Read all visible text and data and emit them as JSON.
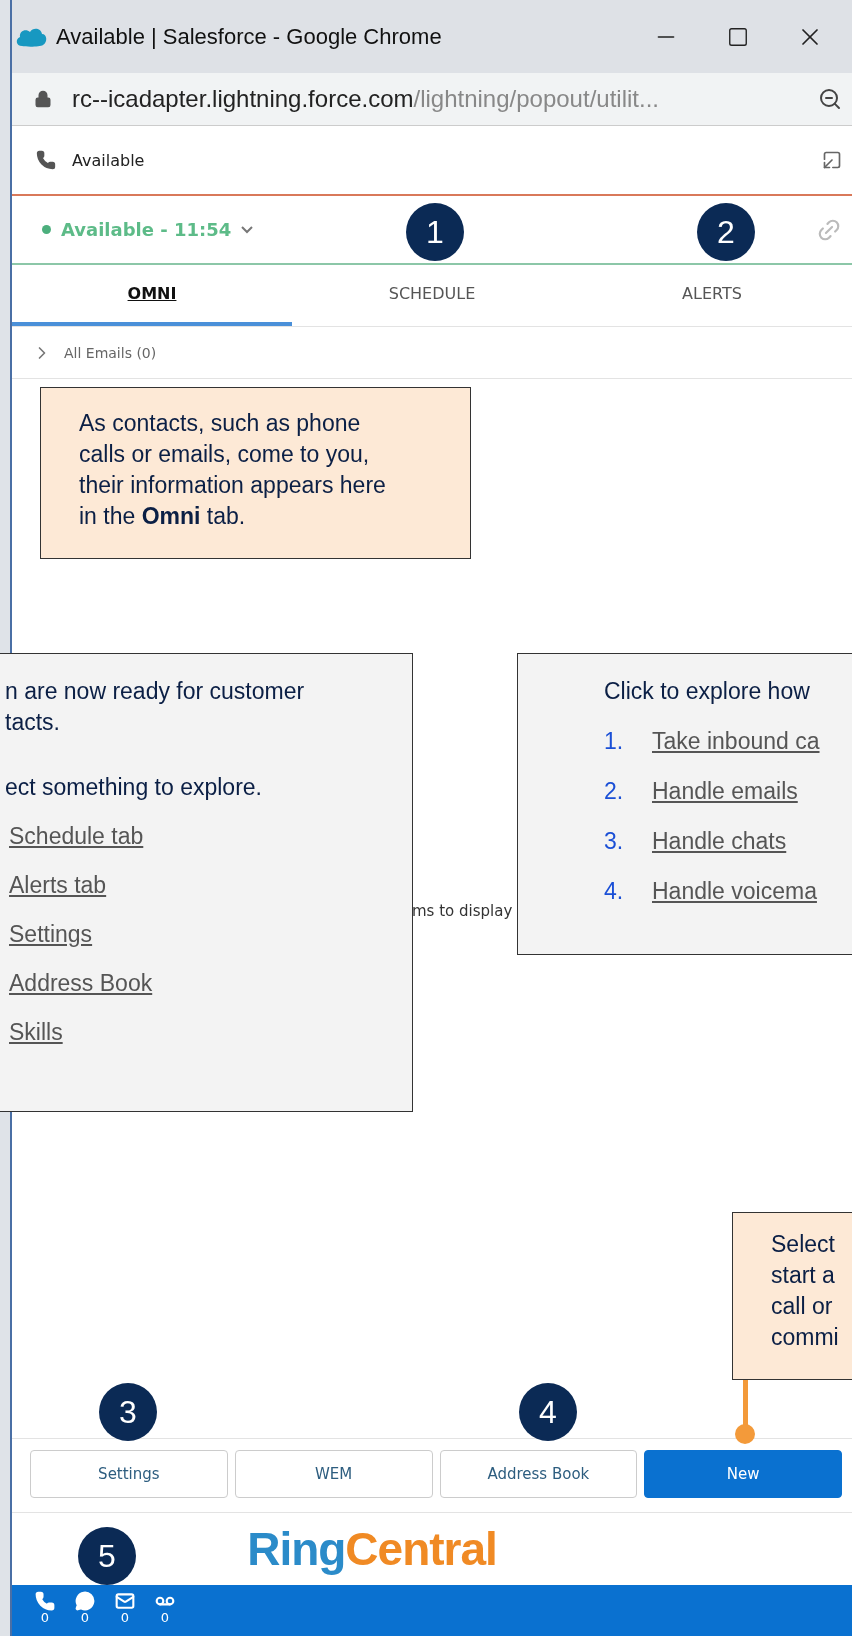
{
  "window": {
    "title": "Available | Salesforce - Google Chrome"
  },
  "address_bar": {
    "host": "rc--icadapter.lightning.force.com",
    "path": "/lightning/popout/utilit..."
  },
  "header": {
    "title": "Available"
  },
  "status": {
    "label": "Available - 11:54"
  },
  "tabs": [
    {
      "label": "OMNI",
      "selected": true
    },
    {
      "label": "SCHEDULE",
      "selected": false
    },
    {
      "label": "ALERTS",
      "selected": false
    }
  ],
  "queue": {
    "label": "All Emails (0)",
    "expanded": false
  },
  "empty_message": "ms to display",
  "callouts": [
    {
      "kind": "note",
      "text": "As contacts, such as phone calls or emails, come to you, their information appears here in the **Omni** tab."
    },
    {
      "kind": "menu",
      "lines": [
        "n are now ready for customer",
        "tacts."
      ],
      "prompt": "ect something to explore.",
      "links": [
        "Schedule tab",
        "Alerts tab",
        "Settings",
        "Address Book",
        "Skills"
      ]
    },
    {
      "kind": "numbered",
      "heading": "Click to explore how",
      "items": [
        {
          "number": "1.",
          "label": "Take inbound ca"
        },
        {
          "number": "2.",
          "label": "Handle emails"
        },
        {
          "number": "3.",
          "label": "Handle chats"
        },
        {
          "number": "4.",
          "label": "Handle voicema"
        }
      ]
    },
    {
      "kind": "pointer",
      "lines": [
        "Select",
        "start a",
        "call or",
        "commi"
      ]
    }
  ],
  "markers": [
    "1",
    "2",
    "3",
    "4",
    "5"
  ],
  "buttons": [
    {
      "label": "Settings",
      "kind": "default"
    },
    {
      "label": "WEM",
      "kind": "default"
    },
    {
      "label": "Address Book",
      "kind": "default"
    },
    {
      "label": "New",
      "kind": "primary"
    }
  ],
  "logo": {
    "first": "Ring",
    "second": "Central"
  },
  "channels": [
    {
      "kind": "phone",
      "count": "0"
    },
    {
      "kind": "chat",
      "count": "0"
    },
    {
      "kind": "email",
      "count": "0"
    },
    {
      "kind": "voicemail",
      "count": "0"
    }
  ]
}
